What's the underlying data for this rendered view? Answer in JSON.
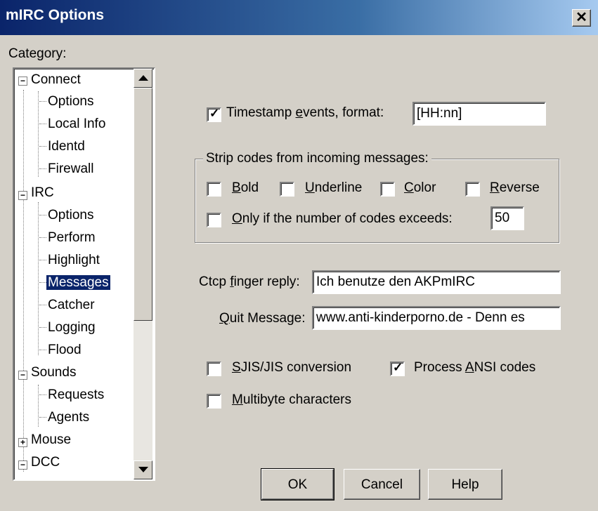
{
  "window": {
    "title": "mIRC Options",
    "close_glyph": "✕"
  },
  "category_label": "Category:",
  "tree": {
    "connect": "Connect",
    "connect_options": "Options",
    "local_info": "Local Info",
    "identd": "Identd",
    "firewall": "Firewall",
    "irc": "IRC",
    "irc_options": "Options",
    "perform": "Perform",
    "highlight": "Highlight",
    "messages": "Messages",
    "catcher": "Catcher",
    "logging": "Logging",
    "flood": "Flood",
    "sounds": "Sounds",
    "requests": "Requests",
    "agents": "Agents",
    "mouse": "Mouse",
    "dcc": "DCC",
    "selected": "Messages"
  },
  "timestamp": {
    "checked": true,
    "label_pre": "Timestamp ",
    "label_u": "e",
    "label_post": "vents, format:",
    "value": "[HH:nn]"
  },
  "strip": {
    "group_label": "Strip codes from incoming messages:",
    "bold_u": "B",
    "bold_rest": "old",
    "underline_u": "U",
    "underline_rest": "nderline",
    "color_u": "C",
    "color_rest": "olor",
    "reverse_u": "R",
    "reverse_rest": "everse",
    "only_u": "O",
    "only_rest": "nly if the number of codes exceeds:",
    "count": "50"
  },
  "ctcp": {
    "label_pre": "Ctcp ",
    "label_u": "f",
    "label_post": "inger reply:",
    "value": "Ich benutze den AKPmIRC"
  },
  "quit": {
    "label_u": "Q",
    "label_post": "uit Message:",
    "value": "www.anti-kinderporno.de - Denn es"
  },
  "sjis": {
    "checked": false,
    "label_u": "S",
    "label_post": "JIS/JIS conversion"
  },
  "ansi": {
    "checked": true,
    "label_pre": "Process ",
    "label_u": "A",
    "label_post": "NSI codes"
  },
  "multibyte": {
    "checked": false,
    "label_u": "M",
    "label_post": "ultibyte characters"
  },
  "buttons": {
    "ok": "OK",
    "cancel": "Cancel",
    "help": "Help"
  }
}
